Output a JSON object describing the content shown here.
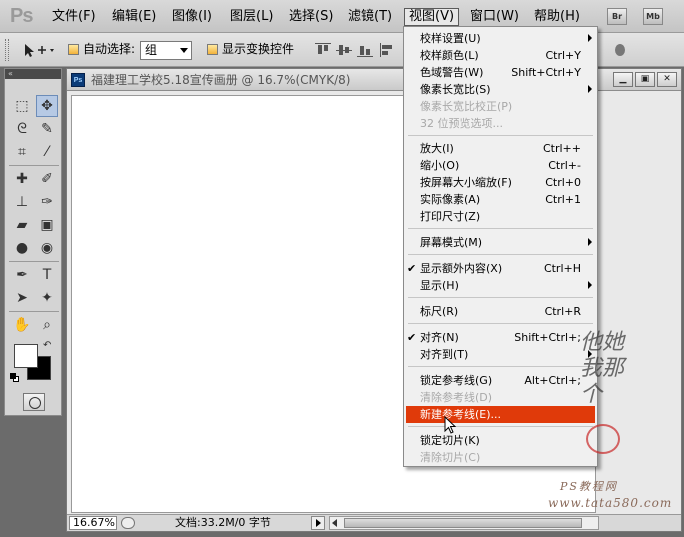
{
  "app": {
    "logo": "Ps",
    "bridge_label": "Br",
    "minibridge_label": "Mb"
  },
  "menubar": [
    {
      "label": "文件(F)"
    },
    {
      "label": "编辑(E)"
    },
    {
      "label": "图像(I)"
    },
    {
      "label": "图层(L)"
    },
    {
      "label": "选择(S)"
    },
    {
      "label": "滤镜(T)"
    },
    {
      "label": "视图(V)"
    },
    {
      "label": "窗口(W)"
    },
    {
      "label": "帮助(H)"
    }
  ],
  "options": {
    "auto_select_label": "自动选择:",
    "auto_select_value": "组",
    "show_transform_label": "显示变换控件"
  },
  "document": {
    "title": "福建理工学校5.18宣传画册 @ 16.7%(CMYK/8)",
    "zoom": "16.67%",
    "info": "文档:33.2M/0 字节"
  },
  "view_menu": {
    "items": [
      {
        "label": "校样设置(U)",
        "shortcut": "",
        "submenu": true
      },
      {
        "label": "校样颜色(L)",
        "shortcut": "Ctrl+Y"
      },
      {
        "label": "色域警告(W)",
        "shortcut": "Shift+Ctrl+Y"
      },
      {
        "label": "像素长宽比(S)",
        "shortcut": "",
        "submenu": true
      },
      {
        "label": "像素长宽比校正(P)",
        "shortcut": "",
        "disabled": true
      },
      {
        "label": "32 位预览选项...",
        "shortcut": "",
        "disabled": true
      },
      {
        "label": "放大(I)",
        "shortcut": "Ctrl++"
      },
      {
        "label": "缩小(O)",
        "shortcut": "Ctrl+-"
      },
      {
        "label": "按屏幕大小缩放(F)",
        "shortcut": "Ctrl+0"
      },
      {
        "label": "实际像素(A)",
        "shortcut": "Ctrl+1"
      },
      {
        "label": "打印尺寸(Z)",
        "shortcut": ""
      },
      {
        "label": "屏幕模式(M)",
        "shortcut": "",
        "submenu": true
      },
      {
        "label": "显示额外内容(X)",
        "shortcut": "Ctrl+H",
        "checked": true
      },
      {
        "label": "显示(H)",
        "shortcut": "",
        "submenu": true
      },
      {
        "label": "标尺(R)",
        "shortcut": "Ctrl+R"
      },
      {
        "label": "对齐(N)",
        "shortcut": "Shift+Ctrl+;",
        "checked": true
      },
      {
        "label": "对齐到(T)",
        "shortcut": "",
        "submenu": true
      },
      {
        "label": "锁定参考线(G)",
        "shortcut": "Alt+Ctrl+;"
      },
      {
        "label": "清除参考线(D)",
        "shortcut": "",
        "disabled": true
      },
      {
        "label": "新建参考线(E)...",
        "shortcut": "",
        "highlighted": true
      },
      {
        "label": "锁定切片(K)",
        "shortcut": ""
      },
      {
        "label": "清除切片(C)",
        "shortcut": "",
        "disabled": true
      }
    ]
  },
  "watermark": {
    "site_name": "PS教程网",
    "url": "www.tata580.com",
    "signature": "他她我那个"
  },
  "colors": {
    "highlight": "#e03a0a",
    "foreground": "#ffffff",
    "background": "#000000"
  }
}
